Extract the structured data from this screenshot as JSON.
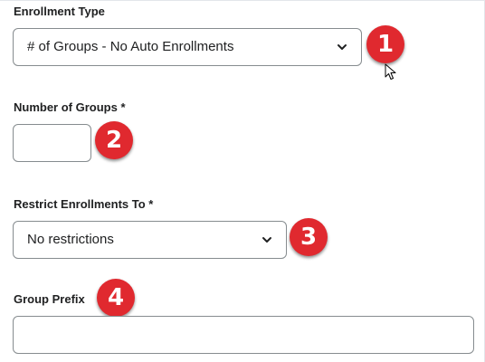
{
  "fields": {
    "enrollment_type": {
      "label": "Enrollment Type",
      "value": "# of Groups - No Auto Enrollments"
    },
    "number_of_groups": {
      "label": "Number of Groups *",
      "value": ""
    },
    "restrict_enrollments": {
      "label": "Restrict Enrollments To *",
      "value": "No restrictions"
    },
    "group_prefix": {
      "label": "Group Prefix",
      "value": ""
    }
  },
  "badges": {
    "one": "1",
    "two": "2",
    "three": "3",
    "four": "4"
  },
  "colors": {
    "badge": "#e0292f",
    "border": "#868c8f",
    "text": "#202122"
  },
  "icons": {
    "dropdown": "chevron-down-icon",
    "cursor": "mouse-pointer-icon"
  }
}
